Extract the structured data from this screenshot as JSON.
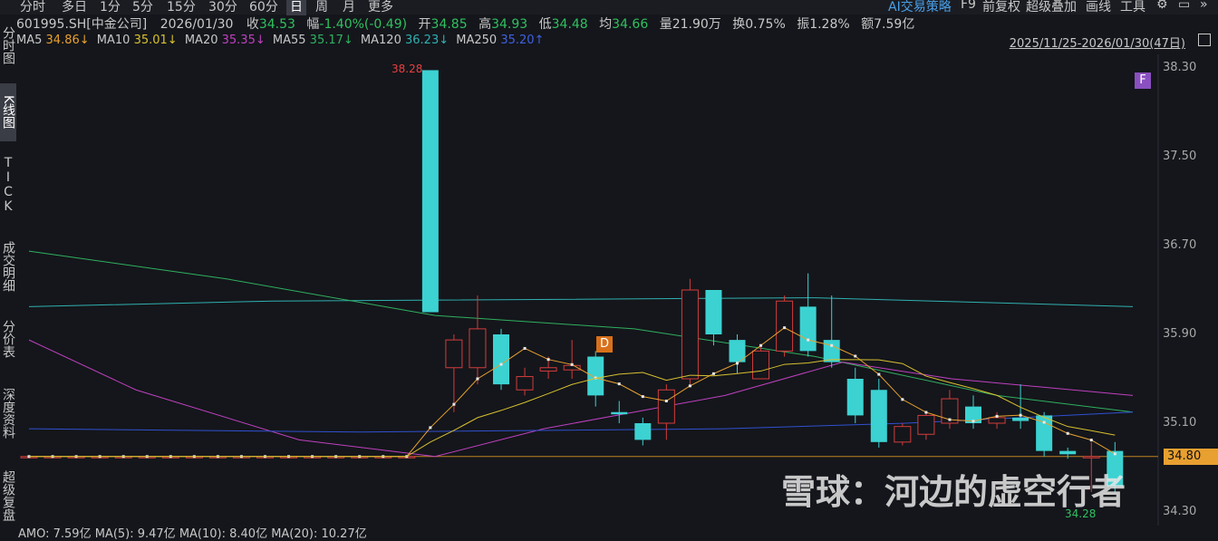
{
  "toolbar": {
    "periods": [
      "分时",
      "多日",
      "1分",
      "5分",
      "15分",
      "30分",
      "60分",
      "日",
      "周",
      "月",
      "更多"
    ],
    "active_period": "日",
    "right": {
      "ai": "AI交易策略",
      "f9": "F9",
      "adjust": "前复权",
      "overlay": "超级叠加",
      "draw": "画线",
      "tools": "工具"
    }
  },
  "sidebar": {
    "tabs": [
      "分时图",
      "K线图",
      "TICK",
      "成交明细",
      "分价表",
      "深度资料",
      "超级复盘"
    ],
    "active": "K线图"
  },
  "info": {
    "code": "601995.SH[中金公司]",
    "date": "2026/01/30",
    "close_label": "收",
    "close": "34.53",
    "change_label": "幅",
    "change": "-1.40%(-0.49)",
    "open_label": "开",
    "open": "34.85",
    "high_label": "高",
    "high": "34.93",
    "low_label": "低",
    "low": "34.48",
    "avg_label": "均",
    "avg": "34.66",
    "vol_label": "量",
    "vol": "21.90万",
    "turnover_label": "换",
    "turnover": "0.75%",
    "amp_label": "振",
    "amp": "1.28%",
    "amount_label": "额",
    "amount": "7.59亿"
  },
  "ma": {
    "ma5_label": "MA5",
    "ma5": "34.86↓",
    "ma10_label": "MA10",
    "ma10": "35.01↓",
    "ma20_label": "MA20",
    "ma20": "35.35↓",
    "ma55_label": "MA55",
    "ma55": "35.17↓",
    "ma120_label": "MA120",
    "ma120": "36.23↓",
    "ma250_label": "MA250",
    "ma250": "35.20↑"
  },
  "date_range": "2025/11/25-2026/01/30(47日)",
  "axis": [
    "38.30",
    "37.50",
    "36.70",
    "35.90",
    "35.10",
    "34.30"
  ],
  "price_line": "34.80",
  "high_marker": "38.28",
  "low_marker": "34.28",
  "flags": {
    "f": "F",
    "d": "D"
  },
  "watermark": "雪球：河边的虚空行者",
  "amo": "AMO: 7.59亿 MA(5): 9.47亿 MA(10): 8.40亿 MA(20): 10.27亿",
  "colors": {
    "up": "#d23c3c",
    "down": "#3cd2d2",
    "ma5": "#e8a030",
    "ma10": "#d8c030",
    "ma20": "#c040c0",
    "ma55": "#30b060",
    "ma120": "#30b0b0",
    "ma250": "#3050d0"
  },
  "chart_data": {
    "type": "candlestick",
    "ylim": [
      34.3,
      38.3
    ],
    "candles": [
      {
        "o": 34.8,
        "c": 34.8,
        "h": 34.8,
        "l": 34.8
      },
      {
        "o": 34.8,
        "c": 34.8,
        "h": 34.8,
        "l": 34.8
      },
      {
        "o": 34.8,
        "c": 34.8,
        "h": 34.8,
        "l": 34.8
      },
      {
        "o": 34.8,
        "c": 34.8,
        "h": 34.8,
        "l": 34.8
      },
      {
        "o": 34.8,
        "c": 34.8,
        "h": 34.8,
        "l": 34.8
      },
      {
        "o": 34.8,
        "c": 34.8,
        "h": 34.8,
        "l": 34.8
      },
      {
        "o": 34.8,
        "c": 34.8,
        "h": 34.8,
        "l": 34.8
      },
      {
        "o": 34.8,
        "c": 34.8,
        "h": 34.8,
        "l": 34.8
      },
      {
        "o": 34.8,
        "c": 34.8,
        "h": 34.8,
        "l": 34.8
      },
      {
        "o": 34.8,
        "c": 34.8,
        "h": 34.8,
        "l": 34.8
      },
      {
        "o": 34.8,
        "c": 34.8,
        "h": 34.8,
        "l": 34.8
      },
      {
        "o": 34.8,
        "c": 34.8,
        "h": 34.8,
        "l": 34.8
      },
      {
        "o": 34.8,
        "c": 34.8,
        "h": 34.8,
        "l": 34.8
      },
      {
        "o": 34.8,
        "c": 34.8,
        "h": 34.8,
        "l": 34.8
      },
      {
        "o": 34.8,
        "c": 34.8,
        "h": 34.8,
        "l": 34.8
      },
      {
        "o": 34.8,
        "c": 34.8,
        "h": 34.8,
        "l": 34.8
      },
      {
        "o": 34.8,
        "c": 34.8,
        "h": 34.8,
        "l": 34.8
      },
      {
        "o": 38.28,
        "c": 36.1,
        "h": 38.28,
        "l": 36.1
      },
      {
        "o": 35.6,
        "c": 35.85,
        "h": 35.9,
        "l": 35.2
      },
      {
        "o": 35.6,
        "c": 35.95,
        "h": 36.25,
        "l": 35.45
      },
      {
        "o": 35.9,
        "c": 35.45,
        "h": 35.95,
        "l": 35.4
      },
      {
        "o": 35.4,
        "c": 35.52,
        "h": 35.6,
        "l": 35.35
      },
      {
        "o": 35.57,
        "c": 35.6,
        "h": 35.7,
        "l": 35.5
      },
      {
        "o": 35.58,
        "c": 35.62,
        "h": 35.85,
        "l": 35.5
      },
      {
        "o": 35.7,
        "c": 35.35,
        "h": 35.75,
        "l": 35.25
      },
      {
        "o": 35.2,
        "c": 35.18,
        "h": 35.3,
        "l": 35.1
      },
      {
        "o": 35.1,
        "c": 34.95,
        "h": 35.15,
        "l": 34.9
      },
      {
        "o": 35.1,
        "c": 35.4,
        "h": 35.45,
        "l": 34.95
      },
      {
        "o": 35.5,
        "c": 36.3,
        "h": 36.4,
        "l": 35.45
      },
      {
        "o": 36.3,
        "c": 35.9,
        "h": 36.3,
        "l": 35.8
      },
      {
        "o": 35.85,
        "c": 35.65,
        "h": 35.9,
        "l": 35.55
      },
      {
        "o": 35.5,
        "c": 35.75,
        "h": 35.8,
        "l": 35.5
      },
      {
        "o": 35.75,
        "c": 36.2,
        "h": 36.25,
        "l": 35.7
      },
      {
        "o": 36.15,
        "c": 35.75,
        "h": 36.45,
        "l": 35.7
      },
      {
        "o": 35.85,
        "c": 35.65,
        "h": 36.25,
        "l": 35.6
      },
      {
        "o": 35.5,
        "c": 35.17,
        "h": 35.6,
        "l": 35.1
      },
      {
        "o": 35.4,
        "c": 34.93,
        "h": 35.5,
        "l": 34.88
      },
      {
        "o": 34.93,
        "c": 35.07,
        "h": 35.1,
        "l": 34.9
      },
      {
        "o": 35.0,
        "c": 35.17,
        "h": 35.2,
        "l": 34.95
      },
      {
        "o": 35.1,
        "c": 35.32,
        "h": 35.4,
        "l": 35.05
      },
      {
        "o": 35.25,
        "c": 35.1,
        "h": 35.35,
        "l": 35.05
      },
      {
        "o": 35.1,
        "c": 35.15,
        "h": 35.2,
        "l": 35.05
      },
      {
        "o": 35.15,
        "c": 35.12,
        "h": 35.45,
        "l": 35.05
      },
      {
        "o": 35.17,
        "c": 34.85,
        "h": 35.2,
        "l": 34.8
      },
      {
        "o": 34.85,
        "c": 34.82,
        "h": 34.88,
        "l": 34.78
      },
      {
        "o": 34.8,
        "c": 34.8,
        "h": 34.93,
        "l": 34.48
      },
      {
        "o": 34.85,
        "c": 34.53,
        "h": 34.93,
        "l": 34.48
      }
    ]
  }
}
